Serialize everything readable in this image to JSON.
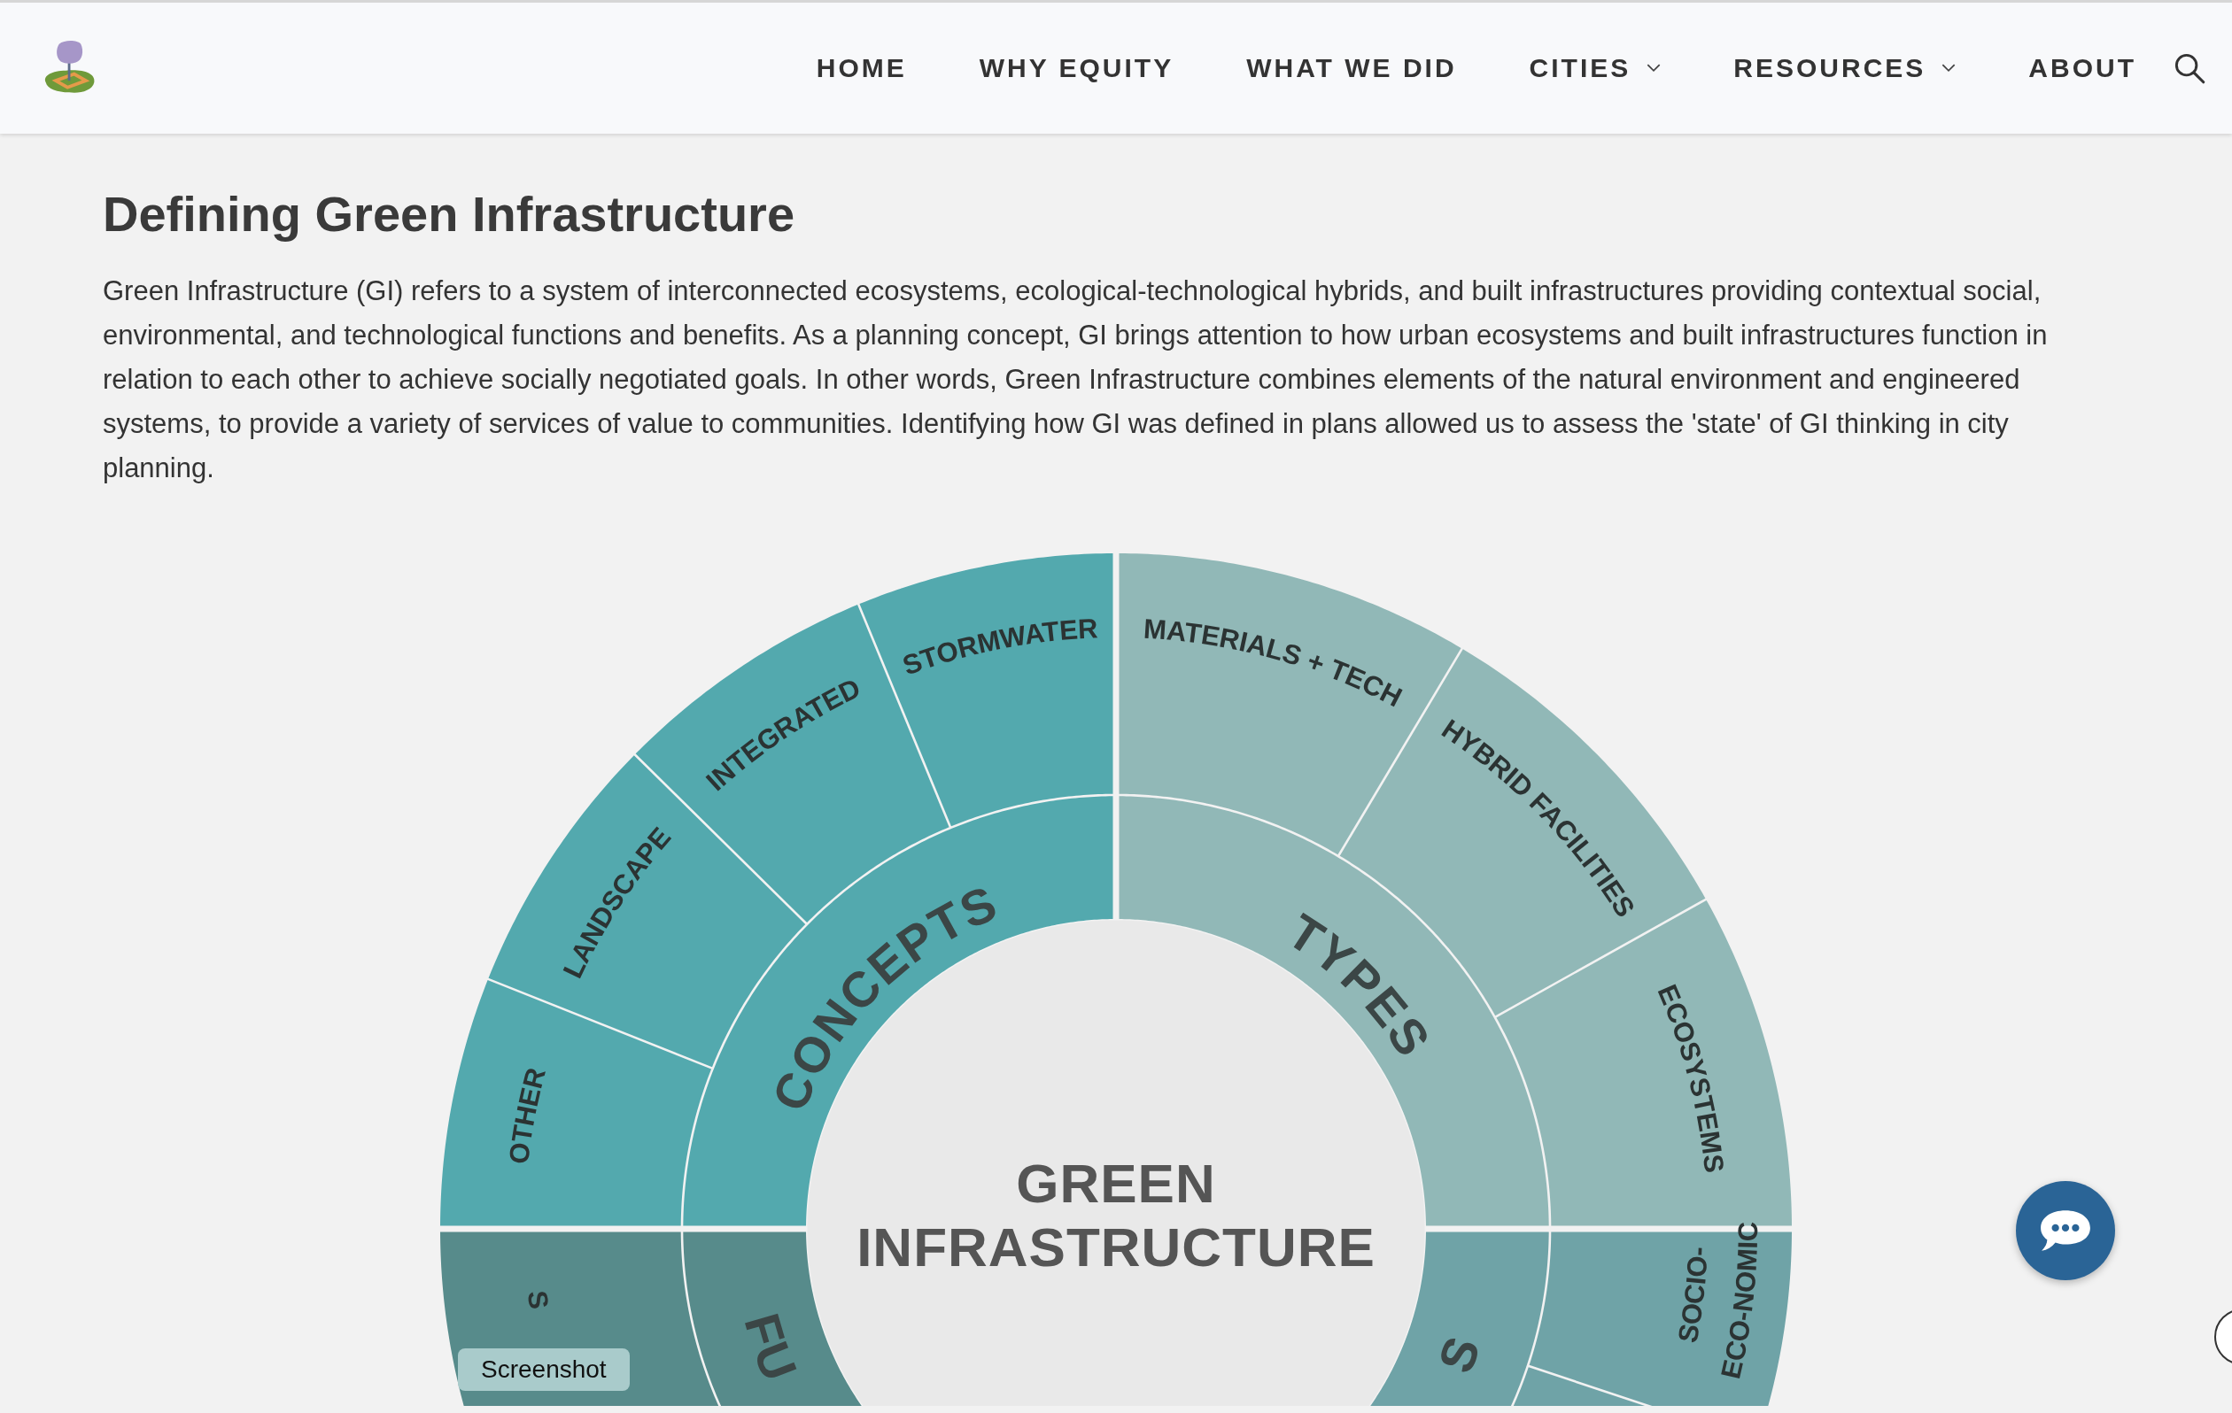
{
  "header": {
    "nav": [
      {
        "label": "HOME",
        "dropdown": false
      },
      {
        "label": "WHY EQUITY",
        "dropdown": false
      },
      {
        "label": "WHAT WE DID",
        "dropdown": false
      },
      {
        "label": "CITIES",
        "dropdown": true
      },
      {
        "label": "RESOURCES",
        "dropdown": true
      },
      {
        "label": "ABOUT",
        "dropdown": false
      }
    ]
  },
  "article": {
    "title": "Defining Green Infrastructure",
    "body": "Green Infrastructure (GI) refers to a system of interconnected ecosystems, ecological-technological hybrids, and built infrastructures providing contextual social, environmental, and technological functions and benefits. As a planning concept, GI brings attention to how urban ecosystems and built infrastructures function in relation to each other to achieve socially negotiated goals. In other words, Green Infrastructure combines elements of the natural environment and engineered systems, to provide a variety of services of value to communities. Identifying how GI was defined in plans allowed us to assess the 'state' of GI thinking in city planning."
  },
  "diagram": {
    "center_lines": [
      "GREEN",
      "INFRASTRUCTURE"
    ],
    "categories": [
      {
        "label": "CONCEPTS",
        "color": "#53a9ae",
        "children": [
          {
            "lines": [
              "OTHER"
            ]
          },
          {
            "lines": [
              "LANDSCAPE"
            ]
          },
          {
            "lines": [
              "INTEGRATED"
            ]
          },
          {
            "lines": [
              "STORMWATER"
            ]
          }
        ]
      },
      {
        "label": "TYPES",
        "color": "#91b8b7",
        "children": [
          {
            "lines": [
              "MATERIALS + TECH"
            ]
          },
          {
            "lines": [
              "HYBRID FACILITIES"
            ]
          },
          {
            "lines": [
              "ECOSYSTEMS"
            ]
          }
        ]
      },
      {
        "label": "FU",
        "color": "#578b8b",
        "children": [
          {
            "lines": [
              "S"
            ]
          }
        ]
      },
      {
        "label": "S",
        "color": "#6fa3a7",
        "children": [
          {
            "lines": [
              "SOCIO-",
              "ECO-NOMIC"
            ]
          }
        ]
      }
    ]
  },
  "tooltip": "Screenshot"
}
